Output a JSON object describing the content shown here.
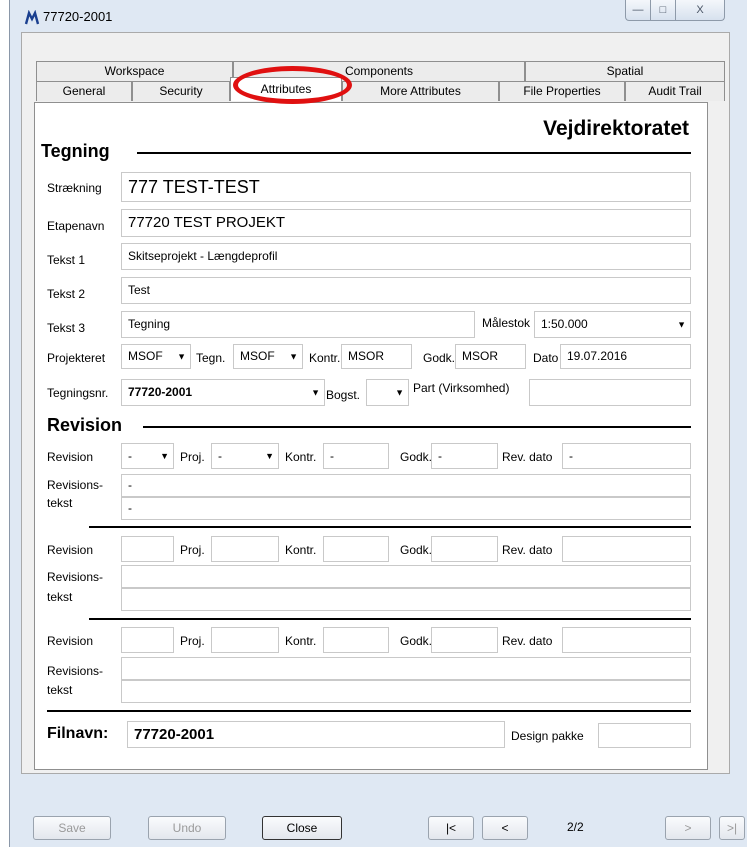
{
  "window": {
    "title": "77720-2001",
    "minimize": "—",
    "maximize": "□",
    "close": "X"
  },
  "tabs": {
    "row1": [
      "Workspace",
      "Components",
      "Spatial"
    ],
    "row2": [
      "General",
      "Security",
      "Attributes",
      "More Attributes",
      "File Properties",
      "Audit Trail"
    ]
  },
  "brand": "Vejdirektoratet",
  "tegning": {
    "title": "Tegning",
    "straekning_label": "Strækning",
    "straekning": "777 TEST-TEST",
    "etapenavn_label": "Etapenavn",
    "etapenavn": "77720 TEST PROJEKT",
    "tekst1_label": "Tekst 1",
    "tekst1": "Skitseprojekt - Længdeprofil",
    "tekst2_label": "Tekst 2",
    "tekst2": "Test",
    "tekst3_label": "Tekst 3",
    "tekst3": "Tegning",
    "malestok_label": "Målestok",
    "malestok": "1:50.000",
    "projekteret_label": "Projekteret",
    "projekteret": "MSOF",
    "tegn_label": "Tegn.",
    "tegn": "MSOF",
    "kontr_label": "Kontr.",
    "kontr": "MSOR",
    "godk_label": "Godk.",
    "godk": "MSOR",
    "dato_label": "Dato",
    "dato": "19.07.2016",
    "tegningsnr_label": "Tegningsnr.",
    "tegningsnr": "77720-2001",
    "bogst_label": "Bogst.",
    "bogst": "",
    "part_label": "Part (Virksomhed)",
    "part": ""
  },
  "revision": {
    "title": "Revision",
    "labels": {
      "revision": "Revision",
      "proj": "Proj.",
      "kontr": "Kontr.",
      "godk": "Godk.",
      "rev_dato": "Rev. dato",
      "revtekst1": "Revisions-",
      "revtekst2": "tekst"
    },
    "blocks": [
      {
        "revision": "-",
        "proj": "-",
        "kontr": "-",
        "godk": "-",
        "rev_dato": "-",
        "tekst1": "-",
        "tekst2": "-"
      },
      {
        "revision": "",
        "proj": "",
        "kontr": "",
        "godk": "",
        "rev_dato": "",
        "tekst1": "",
        "tekst2": ""
      },
      {
        "revision": "",
        "proj": "",
        "kontr": "",
        "godk": "",
        "rev_dato": "",
        "tekst1": "",
        "tekst2": ""
      }
    ]
  },
  "footer": {
    "filnavn_label": "Filnavn:",
    "filnavn": "77720-2001",
    "design_label": "Design pakke",
    "design": ""
  },
  "buttons": {
    "save": "Save",
    "undo": "Undo",
    "close": "Close",
    "first": "|<",
    "prev": "<",
    "page": "2/2",
    "next": ">",
    "last": ">|"
  },
  "colors": {
    "window_bg": "#dfe8f3",
    "panel_bg": "#f0f0f0",
    "highlight_ring": "#e01010"
  }
}
